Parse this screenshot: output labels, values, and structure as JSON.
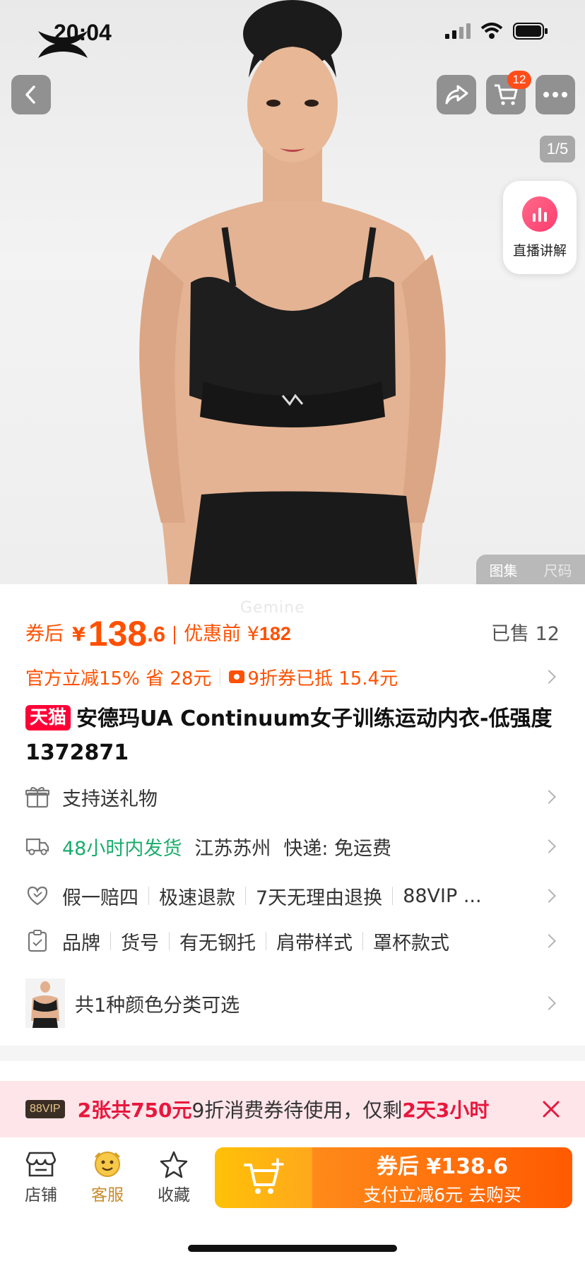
{
  "status": {
    "time": "20:04"
  },
  "hero": {
    "cart_count": "12",
    "image_counter": "1/5",
    "live_label": "直播讲解",
    "tabs": [
      "图集",
      "尺码"
    ],
    "watermark": "Gemine"
  },
  "price": {
    "after_coupon_label": "券后",
    "currency": "¥",
    "integer": "138",
    "decimal": ".6",
    "before_label": "优惠前",
    "original": "182",
    "sold": "已售 12"
  },
  "promo": {
    "official": "官方立减15% 省 28元",
    "coupon": "9折券已抵 15.4元"
  },
  "title": {
    "badge": "天猫",
    "text": "安德玛UA Continuum女子训练运动内衣-低强度1372871"
  },
  "services": {
    "gift": "支持送礼物",
    "shipping_highlight": "48小时内发货",
    "shipping_from": "江苏苏州",
    "shipping_method": "快递: 免运费",
    "guarantees": [
      "假一赔四",
      "极速退款",
      "7天无理由退换",
      "88VIP ..."
    ],
    "params": [
      "品牌",
      "货号",
      "有无钢托",
      "肩带样式",
      "罩杯款式"
    ],
    "colors": "共1种颜色分类可选"
  },
  "vip": {
    "badge": "88VIP",
    "count": "2张共",
    "amount": "750元",
    "mid": "9折消费券待使用，仅剩",
    "remaining": "2天3小时"
  },
  "bottom": {
    "shop": "店铺",
    "service": "客服",
    "favorite": "收藏",
    "buy_line1": "券后 ¥138.6",
    "buy_line2": "支付立减6元  去购买"
  },
  "colors": {
    "accent": "#ff5000",
    "tmall_red": "#ff0036",
    "green": "#1aad6c",
    "vip_bg": "#fde5ea"
  }
}
